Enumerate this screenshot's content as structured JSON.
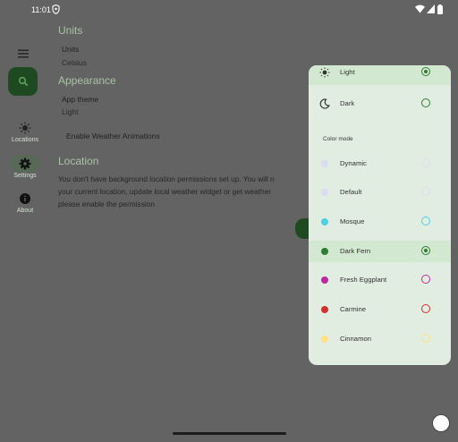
{
  "status": {
    "time": "11:01",
    "icons": [
      "location-shield-icon",
      "wifi-icon",
      "signal-icon",
      "battery-icon"
    ]
  },
  "rail": {
    "menu_icon": "menu-icon",
    "fab_icon": "search-icon",
    "items": [
      {
        "label": "Locations",
        "icon": "sun-icon"
      },
      {
        "label": "Settings",
        "icon": "gear-icon"
      },
      {
        "label": "About",
        "icon": "info-icon"
      }
    ]
  },
  "settings": {
    "units_header": "Units",
    "units_title": "Units",
    "units_value": "Celsius",
    "appearance_header": "Appearance",
    "theme_title": "App theme",
    "theme_value": "Light",
    "animations": "Enable Weather Animations",
    "location_header": "Location",
    "location_lines": [
      "You don't have background location permissions set up. You will n",
      "your current location, update local weather widget or get weather",
      "please enable the permission"
    ]
  },
  "sheet": {
    "theme_options": [
      {
        "label": "Light",
        "icon": "sun-icon",
        "selected": true
      },
      {
        "label": "Dark",
        "icon": "moon-icon",
        "selected": false
      }
    ],
    "color_mode_label": "Color mode",
    "color_options": [
      {
        "label": "Dynamic",
        "color": "#dcdcf0",
        "selected": false
      },
      {
        "label": "Default",
        "color": "#dcdcf0",
        "selected": false
      },
      {
        "label": "Mosque",
        "color": "#4dd0e1",
        "selected": false
      },
      {
        "label": "Dark Fern",
        "color": "#2e7d32",
        "selected": true
      },
      {
        "label": "Fresh Eggplant",
        "color": "#c0279a",
        "selected": false
      },
      {
        "label": "Carmine",
        "color": "#d32f2f",
        "selected": false
      },
      {
        "label": "Cinnamon",
        "color": "#ffe082",
        "selected": false
      }
    ]
  }
}
